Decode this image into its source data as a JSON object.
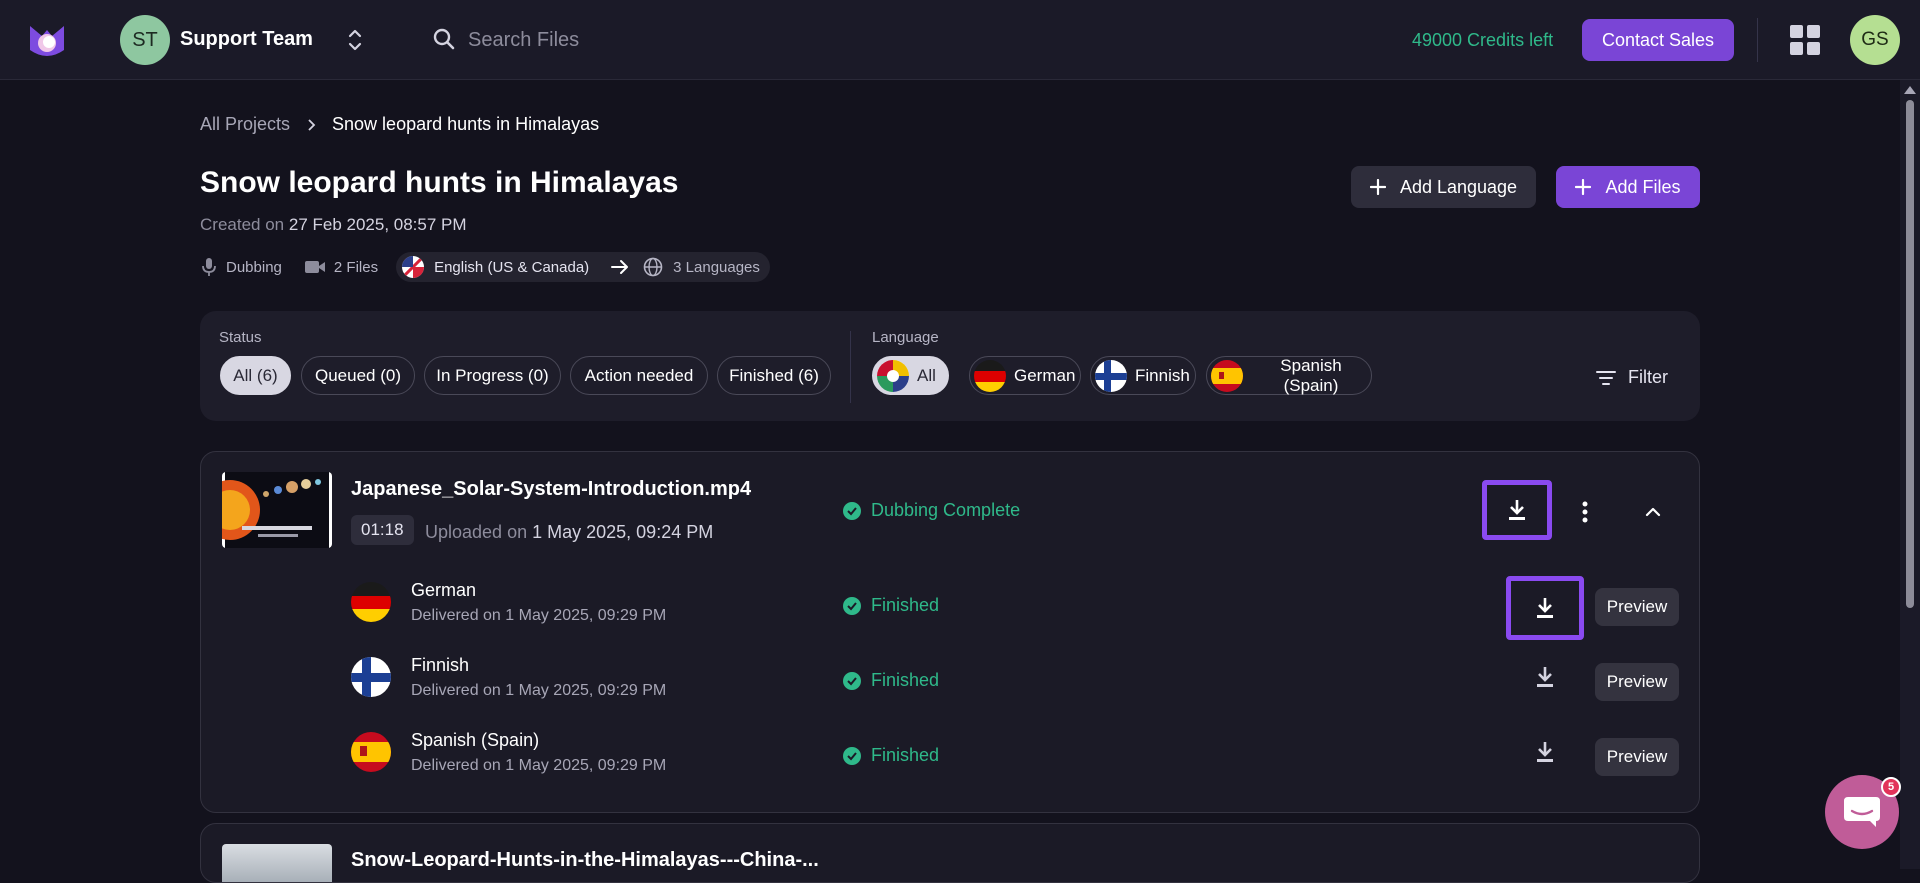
{
  "topbar": {
    "team_initials": "ST",
    "team_name": "Support Team",
    "search_placeholder": "Search Files",
    "credits": "49000 Credits left",
    "contact_label": "Contact Sales",
    "user_initials": "GS"
  },
  "breadcrumb": {
    "root": "All Projects",
    "current": "Snow leopard hunts in Himalayas"
  },
  "project": {
    "title": "Snow leopard hunts in Himalayas",
    "created_prefix": "Created on",
    "created_date": "27 Feb 2025, 08:57 PM",
    "type": "Dubbing",
    "files": "2 Files",
    "source_language": "English (US & Canada)",
    "target_languages": "3 Languages",
    "add_language_label": "Add Language",
    "add_files_label": "Add Files"
  },
  "filters": {
    "status_label": "Status",
    "status_chips": [
      "All (6)",
      "Queued (0)",
      "In Progress (0)",
      "Action needed",
      "Finished (6)"
    ],
    "language_label": "Language",
    "language_chips": [
      "All",
      "German",
      "Finnish",
      "Spanish (Spain)"
    ],
    "filter_label": "Filter"
  },
  "files": [
    {
      "name": "Japanese_Solar-System-Introduction.mp4",
      "duration": "01:18",
      "uploaded_prefix": "Uploaded on",
      "uploaded_date": "1 May 2025, 09:24 PM",
      "status": "Dubbing Complete",
      "languages": [
        {
          "name": "German",
          "delivered": "Delivered on 1 May 2025, 09:29 PM",
          "status": "Finished",
          "preview": "Preview"
        },
        {
          "name": "Finnish",
          "delivered": "Delivered on 1 May 2025, 09:29 PM",
          "status": "Finished",
          "preview": "Preview"
        },
        {
          "name": "Spanish (Spain)",
          "delivered": "Delivered on 1 May 2025, 09:29 PM",
          "status": "Finished",
          "preview": "Preview"
        }
      ]
    },
    {
      "name": "Snow-Leopard-Hunts-in-the-Himalayas---China-..."
    }
  ],
  "chat": {
    "badge": "5"
  },
  "colors": {
    "accent": "#7a45d6",
    "success": "#2fb98a",
    "highlight": "#8a4af0",
    "background": "#13121d"
  }
}
